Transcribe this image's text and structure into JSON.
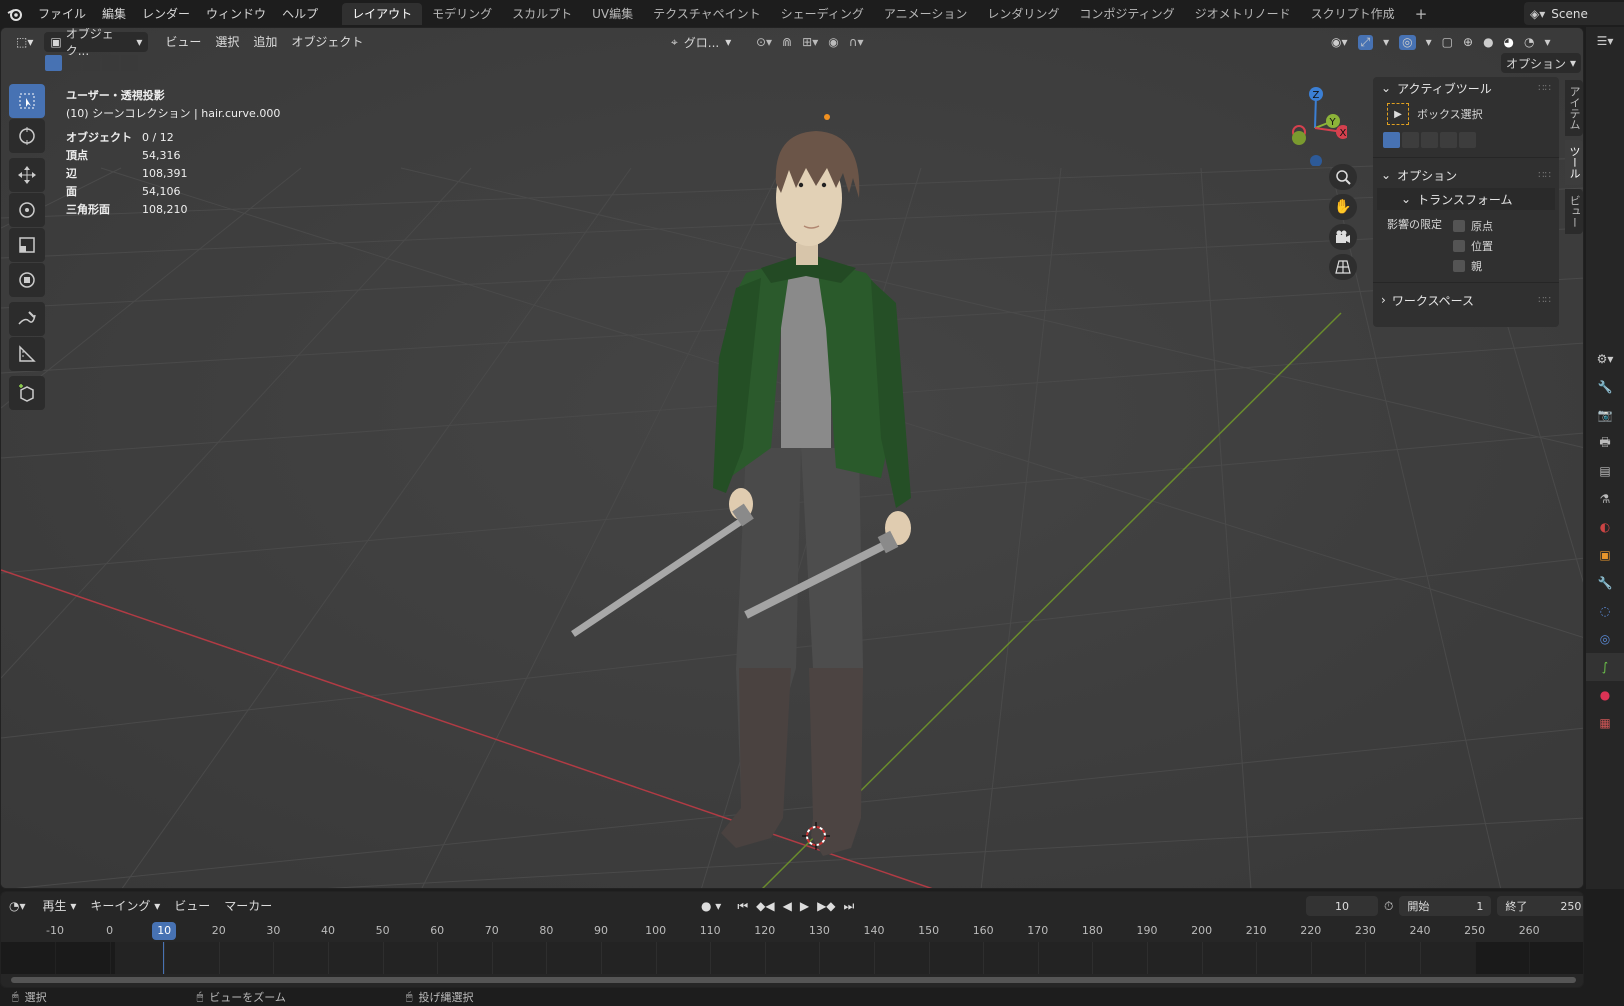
{
  "app": {
    "scene_name": "Scene"
  },
  "menu": [
    "ファイル",
    "編集",
    "レンダー",
    "ウィンドウ",
    "ヘルプ"
  ],
  "workspaces": [
    {
      "label": "レイアウト",
      "active": true
    },
    {
      "label": "モデリング"
    },
    {
      "label": "スカルプト"
    },
    {
      "label": "UV編集"
    },
    {
      "label": "テクスチャペイント"
    },
    {
      "label": "シェーディング"
    },
    {
      "label": "アニメーション"
    },
    {
      "label": "レンダリング"
    },
    {
      "label": "コンポジティング"
    },
    {
      "label": "ジオメトリノード"
    },
    {
      "label": "スクリプト作成"
    }
  ],
  "viewport_header": {
    "mode": "オブジェク...",
    "menus": [
      "ビュー",
      "選択",
      "追加",
      "オブジェクト"
    ],
    "transform_orientation": "グロ...",
    "options_label": "オプション"
  },
  "overlay": {
    "view_name": "ユーザー・透視投影",
    "collection": "(10) シーンコレクション | hair.curve.000"
  },
  "stats": [
    {
      "label": "オブジェクト",
      "value": "0 / 12"
    },
    {
      "label": "頂点",
      "value": "54,316"
    },
    {
      "label": "辺",
      "value": "108,391"
    },
    {
      "label": "面",
      "value": "54,106"
    },
    {
      "label": "三角形面",
      "value": "108,210"
    }
  ],
  "gizmo": {
    "z": "Z",
    "y": "Y",
    "x": "X"
  },
  "npanel": {
    "active_tool_header": "アクティブツール",
    "tool_name": "ボックス選択",
    "options_header": "オプション",
    "transform_header": "トランスフォーム",
    "affect_only_label": "影響の限定",
    "checkboxes": [
      "原点",
      "位置",
      "親"
    ],
    "workspace_header": "ワークスペース",
    "tabs": [
      "アイテム",
      "ツール",
      "ビュー"
    ]
  },
  "timeline": {
    "playback": "再生",
    "keying": "キーイング",
    "view": "ビュー",
    "marker": "マーカー",
    "current_frame": "10",
    "start_label": "開始",
    "start_value": "1",
    "end_label": "終了",
    "end_value": "250",
    "ticks": [
      "-10",
      "0",
      "10",
      "20",
      "30",
      "40",
      "50",
      "60",
      "70",
      "80",
      "90",
      "100",
      "110",
      "120",
      "130",
      "140",
      "150",
      "160",
      "170",
      "180",
      "190",
      "200",
      "210",
      "220",
      "230",
      "240",
      "250",
      "260"
    ]
  },
  "statusbar": {
    "select": "選択",
    "zoom": "ビューをズーム",
    "lasso": "投げ縄選択"
  }
}
